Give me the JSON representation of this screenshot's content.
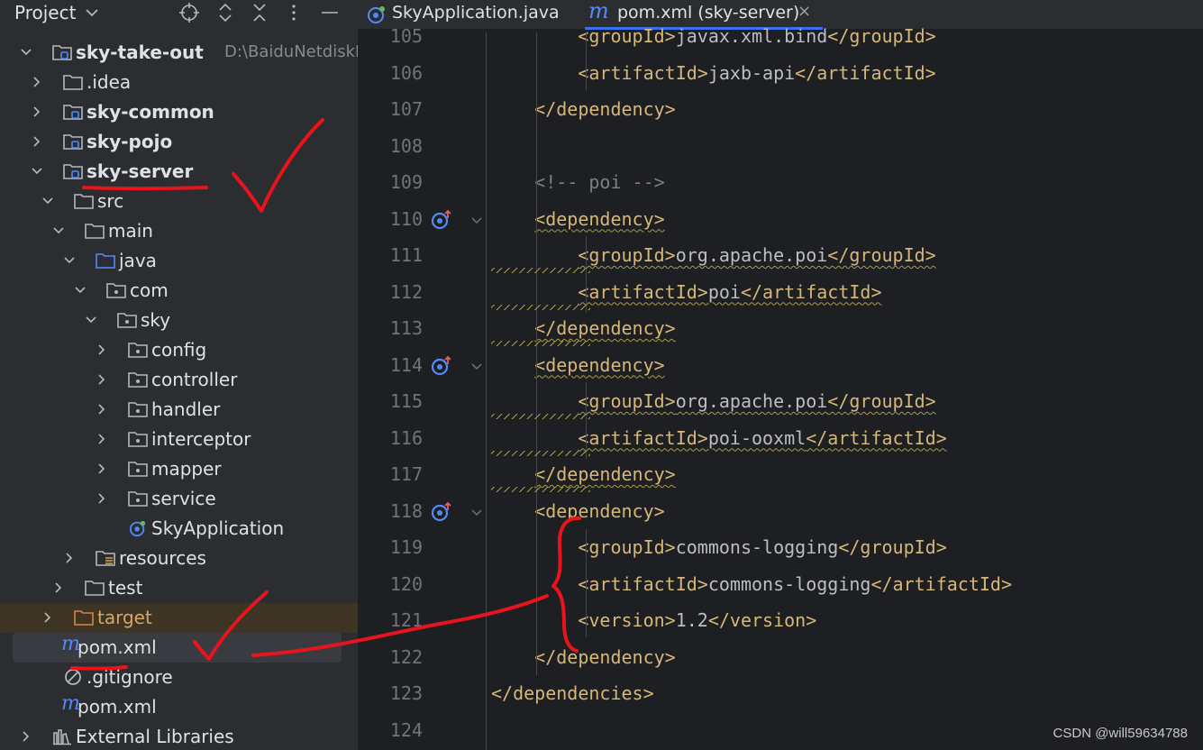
{
  "project_panel": {
    "title": "Project",
    "tree": [
      {
        "label": "sky-take-out",
        "path": "D:\\BaiduNetdiskD",
        "icon": "module-folder-icon",
        "expanded": true,
        "bold": true
      },
      {
        "label": ".idea",
        "icon": "folder-icon",
        "expanded": false
      },
      {
        "label": "sky-common",
        "icon": "module-folder-icon",
        "expanded": false,
        "bold": true
      },
      {
        "label": "sky-pojo",
        "icon": "module-folder-icon",
        "expanded": false,
        "bold": true
      },
      {
        "label": "sky-server",
        "icon": "module-folder-icon",
        "expanded": true,
        "bold": true
      },
      {
        "label": "src",
        "icon": "folder-icon",
        "expanded": true
      },
      {
        "label": "main",
        "icon": "folder-icon",
        "expanded": true
      },
      {
        "label": "java",
        "icon": "source-folder-icon",
        "expanded": true
      },
      {
        "label": "com",
        "icon": "package-icon",
        "expanded": true
      },
      {
        "label": "sky",
        "icon": "package-icon",
        "expanded": true
      },
      {
        "label": "config",
        "icon": "package-icon",
        "expanded": false
      },
      {
        "label": "controller",
        "icon": "package-icon",
        "expanded": false
      },
      {
        "label": "handler",
        "icon": "package-icon",
        "expanded": false
      },
      {
        "label": "interceptor",
        "icon": "package-icon",
        "expanded": false
      },
      {
        "label": "mapper",
        "icon": "package-icon",
        "expanded": false
      },
      {
        "label": "service",
        "icon": "package-icon",
        "expanded": false
      },
      {
        "label": "SkyApplication",
        "icon": "spring-boot-class-icon"
      },
      {
        "label": "resources",
        "icon": "resources-folder-icon",
        "expanded": false
      },
      {
        "label": "test",
        "icon": "folder-icon",
        "expanded": false
      },
      {
        "label": "target",
        "icon": "excluded-folder-icon",
        "expanded": false
      },
      {
        "label": "pom.xml",
        "icon": "maven-pom-icon",
        "selected": true
      },
      {
        "label": ".gitignore",
        "icon": "gitignore-icon"
      },
      {
        "label": "pom.xml",
        "icon": "maven-pom-icon"
      },
      {
        "label": "External Libraries",
        "icon": "libraries-icon",
        "expanded": false
      }
    ]
  },
  "tabs": [
    {
      "label": "SkyApplication.java",
      "icon": "spring-boot-class-icon",
      "active": false
    },
    {
      "label": "pom.xml (sky-server)",
      "icon": "maven-pom-icon",
      "active": true,
      "close": "×"
    }
  ],
  "editor": {
    "lines": [
      {
        "number": "105",
        "code": "        <groupId>javax.xml.bind</groupId>"
      },
      {
        "number": "106",
        "code": "        <artifactId>jaxb-api</artifactId>"
      },
      {
        "number": "107",
        "code": "    </dependency>"
      },
      {
        "number": "108",
        "code": ""
      },
      {
        "number": "109",
        "code": "    <!-- poi -->"
      },
      {
        "number": "110",
        "code": "    <dependency>"
      },
      {
        "number": "111",
        "code": "        <groupId>org.apache.poi</groupId>"
      },
      {
        "number": "112",
        "code": "        <artifactId>poi</artifactId>"
      },
      {
        "number": "113",
        "code": "    </dependency>"
      },
      {
        "number": "114",
        "code": "    <dependency>"
      },
      {
        "number": "115",
        "code": "        <groupId>org.apache.poi</groupId>"
      },
      {
        "number": "116",
        "code": "        <artifactId>poi-ooxml</artifactId>"
      },
      {
        "number": "117",
        "code": "    </dependency>"
      },
      {
        "number": "118",
        "code": "    <dependency>"
      },
      {
        "number": "119",
        "code": "        <groupId>commons-logging</groupId>"
      },
      {
        "number": "120",
        "code": "        <artifactId>commons-logging</artifactId>"
      },
      {
        "number": "121",
        "code": "        <version>1.2</version>"
      },
      {
        "number": "122",
        "code": "    </dependency>"
      },
      {
        "number": "123",
        "code": "</dependencies>"
      },
      {
        "number": "124",
        "code": ""
      }
    ]
  },
  "watermark": "CSDN @will59634788",
  "colors": {
    "tag": "#d5b778",
    "text": "#bcbec4",
    "comment": "#7a7e85",
    "annotation_red": "#e8141c",
    "accent_blue": "#3574f0"
  }
}
